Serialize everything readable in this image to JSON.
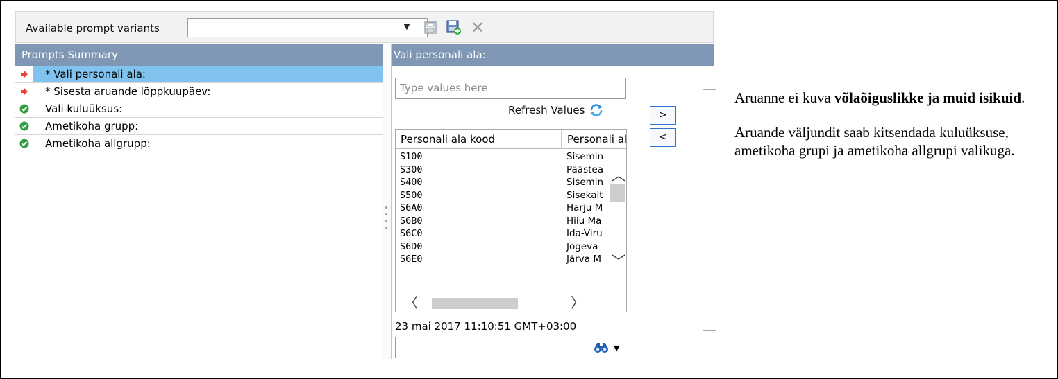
{
  "toolbar": {
    "variants_label": "Available prompt variants",
    "variant_value": "",
    "icons": [
      "save-icon",
      "save-as-icon",
      "delete-icon"
    ]
  },
  "summary": {
    "title": "Prompts Summary",
    "items": [
      {
        "label": "* Vali personali ala:",
        "status": "required",
        "selected": true
      },
      {
        "label": "* Sisesta aruande lõppkuupäev:",
        "status": "required",
        "selected": false
      },
      {
        "label": "Vali kuluüksus:",
        "status": "ok",
        "selected": false
      },
      {
        "label": "Ametikoha grupp:",
        "status": "ok",
        "selected": false
      },
      {
        "label": "Ametikoha allgrupp:",
        "status": "ok",
        "selected": false
      }
    ]
  },
  "detail": {
    "title": "Vali personali ala:",
    "type_placeholder": "Type values here",
    "refresh_label": "Refresh Values",
    "add_label": ">",
    "remove_label": "<",
    "columns": [
      "Personali ala kood",
      "Personali al"
    ],
    "rows": [
      [
        "S100",
        "Sisemin"
      ],
      [
        "S300",
        "Päästea"
      ],
      [
        "S400",
        "Sisemin"
      ],
      [
        "S500",
        "Sisekait"
      ],
      [
        "S6A0",
        "Harju M"
      ],
      [
        "S6B0",
        "Hiiu Ma"
      ],
      [
        "S6C0",
        "Ida-Viru"
      ],
      [
        "S6D0",
        "Jõgeva"
      ],
      [
        "S6E0",
        "Järva M"
      ]
    ],
    "timestamp": "23 mai 2017 11:10:51 GMT+03:00",
    "search_value": ""
  },
  "colors": {
    "header_bg": "#7f97b4",
    "selected_row": "#7fc3ee",
    "required_arrow": "#e8443a",
    "ok_check": "#2e9e3e"
  },
  "note": {
    "p1_prefix": "Aruanne ei kuva ",
    "p1_bold": "võlaõiguslikke ja muid isikuid",
    "p1_suffix": ".",
    "p2": "Aruande väljundit saab kitsendada kuluüksuse, ametikoha grupi ja ametikoha allgrupi valikuga."
  }
}
